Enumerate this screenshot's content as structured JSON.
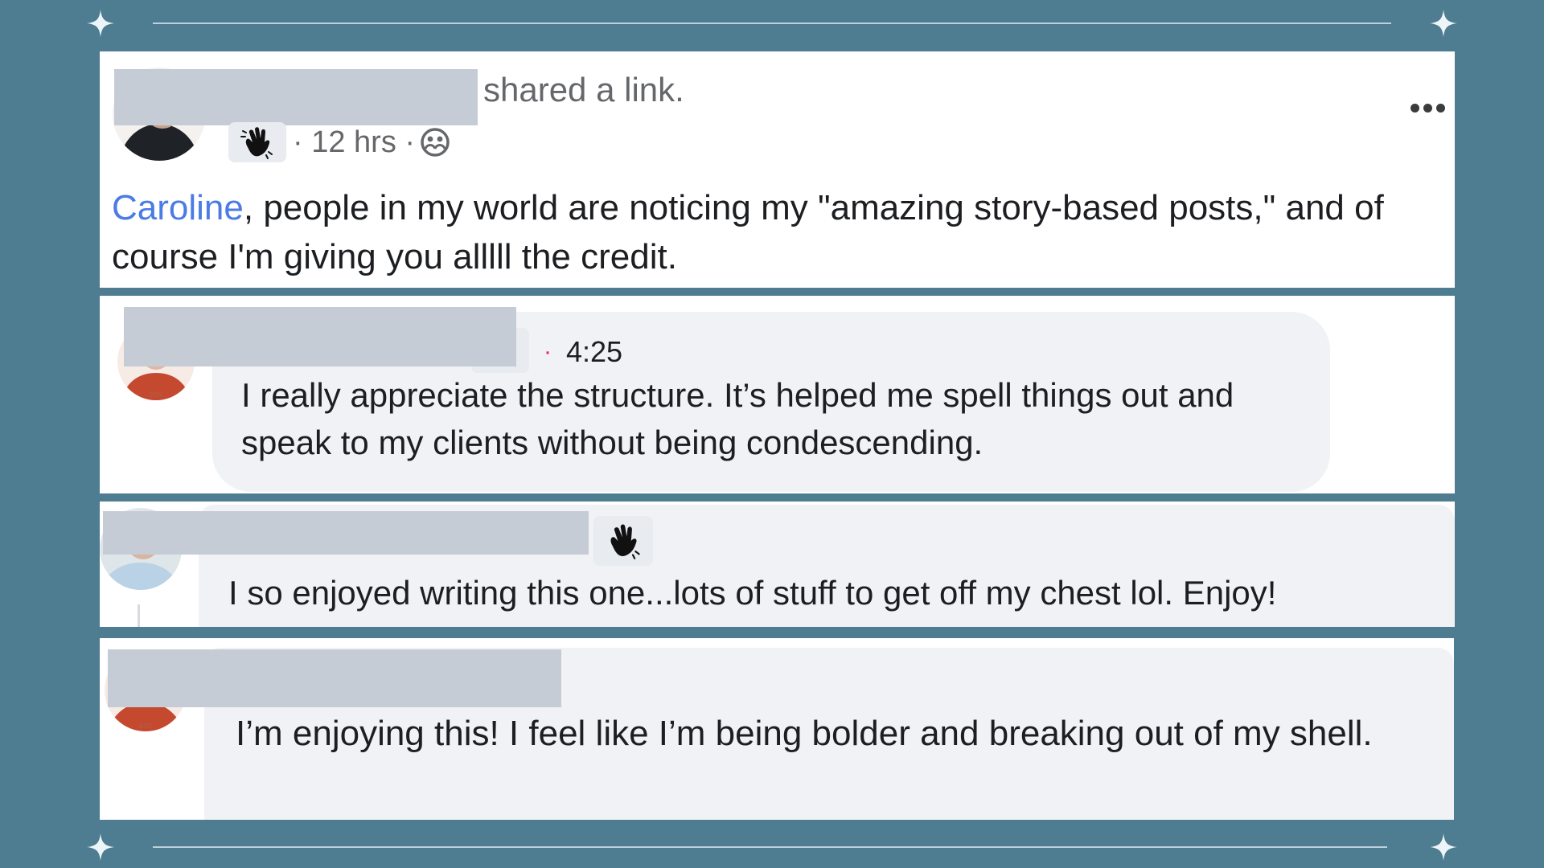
{
  "post": {
    "action_text": "shared a link.",
    "meta": "· 12 hrs ·",
    "mention": "Caroline",
    "body": ", people in my world are noticing my \"amazing story-based posts,\" and of course I'm giving you alllll the credit."
  },
  "comments": [
    {
      "time": "4:25",
      "separator": "·",
      "text": "I really appreciate the structure. It’s helped me spell things out and speak to my clients without being condescending."
    },
    {
      "text": "I so enjoyed writing this one...lots of stuff to get off my chest lol. Enjoy!"
    },
    {
      "text": "I’m enjoying this! I feel like I’m being bolder and breaking out of my shell."
    }
  ],
  "icons": {
    "more": "more-options-icon",
    "wave": "waving-hand-icon",
    "audience": "audience-group-icon",
    "sparkle": "sparkle-icon"
  },
  "colors": {
    "background": "#4e7c91",
    "mention": "#4b7be5",
    "bubble": "#f0f2f5",
    "redaction": "#c6ccd6",
    "meta_text": "#65676b"
  }
}
